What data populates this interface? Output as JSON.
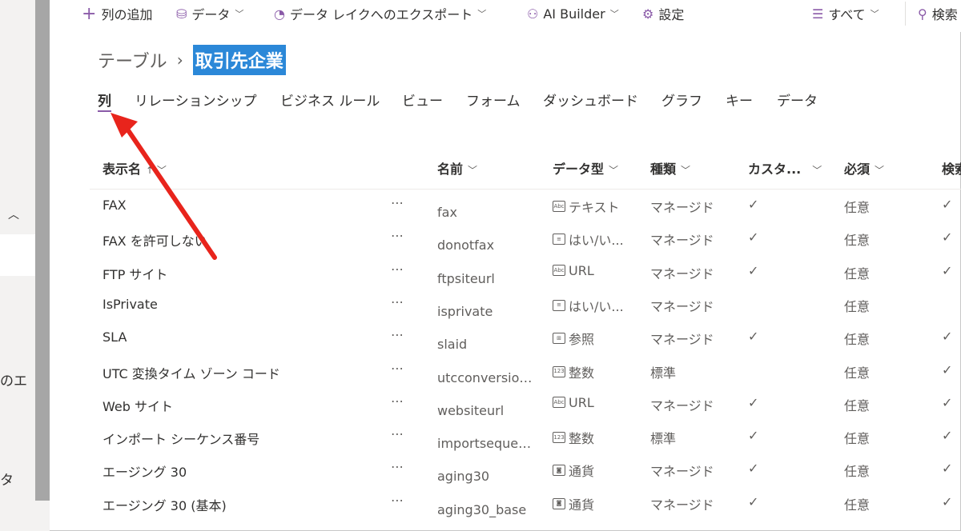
{
  "sidebar": {
    "fragment_1": "のエ",
    "fragment_2": "タ"
  },
  "toolbar": {
    "add_column": "列の追加",
    "data": "データ",
    "export": "データ レイクへのエクスポート",
    "ai_builder": "AI Builder",
    "settings": "設定",
    "filter": "すべて",
    "search": "検索"
  },
  "breadcrumb": {
    "parent": "テーブル",
    "current": "取引先企業"
  },
  "tabs": [
    "列",
    "リレーションシップ",
    "ビジネス ルール",
    "ビュー",
    "フォーム",
    "ダッシュボード",
    "グラフ",
    "キー",
    "データ"
  ],
  "columns": {
    "display_name": "表示名",
    "name": "名前",
    "data_type": "データ型",
    "kind": "種類",
    "custom": "カスタ...",
    "required": "必須",
    "searchable": "検索"
  },
  "rows": [
    {
      "display": "FAX",
      "name": "fax",
      "type_icon": "text-icon",
      "type": "テキスト",
      "kind": "マネージド",
      "custom": "✓",
      "required": "任意",
      "search": "✓"
    },
    {
      "display": "FAX を許可しない",
      "name": "donotfax",
      "type_icon": "choice-icon",
      "type": "はい/い...",
      "kind": "マネージド",
      "custom": "✓",
      "required": "任意",
      "search": "✓"
    },
    {
      "display": "FTP サイト",
      "name": "ftpsiteurl",
      "type_icon": "text-icon",
      "type": "URL",
      "kind": "マネージド",
      "custom": "✓",
      "required": "任意",
      "search": "✓"
    },
    {
      "display": "IsPrivate",
      "name": "isprivate",
      "type_icon": "choice-icon",
      "type": "はい/い...",
      "kind": "マネージド",
      "custom": "",
      "required": "任意",
      "search": ""
    },
    {
      "display": "SLA",
      "name": "slaid",
      "type_icon": "lookup-icon",
      "type": "参照",
      "kind": "マネージド",
      "custom": "✓",
      "required": "任意",
      "search": "✓"
    },
    {
      "display": "UTC 変換タイム ゾーン コード",
      "name": "utcconversion...",
      "type_icon": "number-icon",
      "type": "整数",
      "kind": "標準",
      "custom": "",
      "required": "任意",
      "search": "✓"
    },
    {
      "display": "Web サイト",
      "name": "websiteurl",
      "type_icon": "text-icon",
      "type": "URL",
      "kind": "マネージド",
      "custom": "✓",
      "required": "任意",
      "search": "✓"
    },
    {
      "display": "インポート シーケンス番号",
      "name": "importsequen...",
      "type_icon": "number-icon",
      "type": "整数",
      "kind": "標準",
      "custom": "✓",
      "required": "任意",
      "search": "✓"
    },
    {
      "display": "エージング 30",
      "name": "aging30",
      "type_icon": "currency-icon",
      "type": "通貨",
      "kind": "マネージド",
      "custom": "✓",
      "required": "任意",
      "search": "✓"
    },
    {
      "display": "エージング 30 (基本)",
      "name": "aging30_base",
      "type_icon": "currency-icon",
      "type": "通貨",
      "kind": "マネージド",
      "custom": "✓",
      "required": "任意",
      "search": "✓"
    }
  ],
  "colors": {
    "accent": "#8a5aa8",
    "selection": "#2b88d8",
    "annotation_arrow": "#e8241c"
  }
}
